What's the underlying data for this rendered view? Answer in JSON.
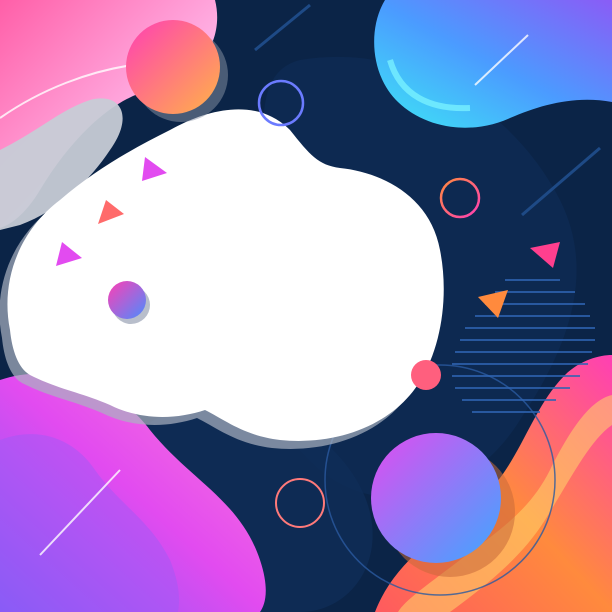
{
  "canvas": {
    "background": "#0b2447",
    "text": []
  },
  "palette": {
    "navy": "#0b2447",
    "navy_light": "#133462",
    "cloud": "#ffffff",
    "cloud_shadow": "#c7ccd6",
    "pink": "#ff3fb4",
    "magenta": "#e24bf0",
    "violet": "#8a5cf6",
    "orange": "#ff8a3d",
    "yellow": "#ffd66b",
    "cyan": "#3de6f5",
    "blue": "#4b8cff"
  },
  "elements": [
    "wave-top-left",
    "wave-top-right",
    "wave-bottom-left",
    "wave-bottom-right",
    "cloud-blob",
    "circle-orange-pink",
    "circle-violet-blue",
    "circle-small",
    "ring-outlines",
    "triangles",
    "hatch-lines"
  ]
}
